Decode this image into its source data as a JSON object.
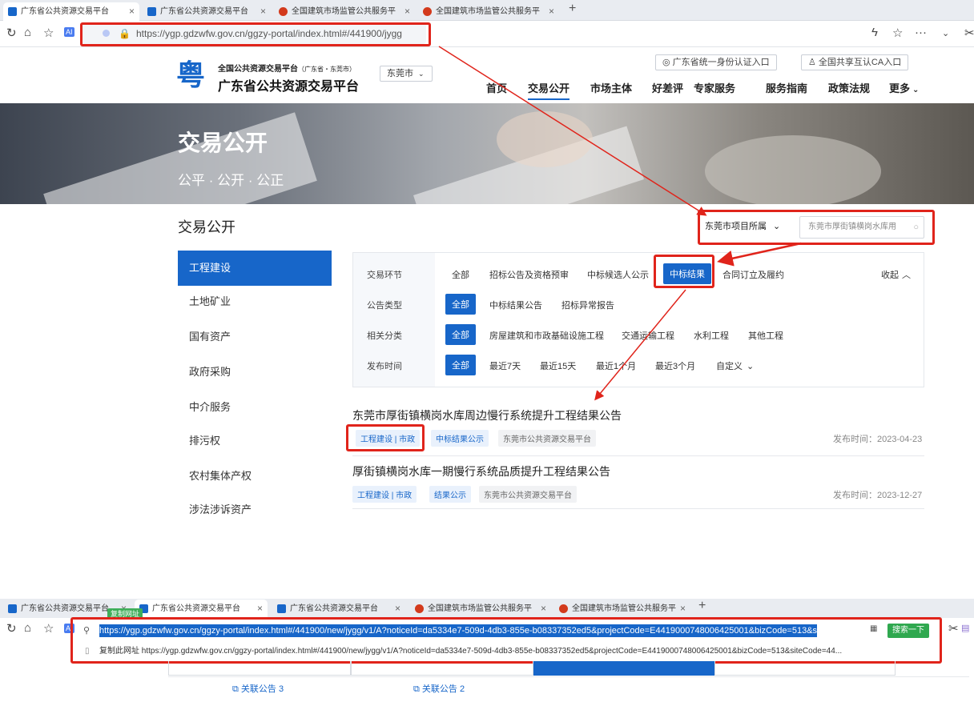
{
  "browser": {
    "tabs": [
      {
        "label": "广东省公共资源交易平台",
        "active": true
      },
      {
        "label": "广东省公共资源交易平台",
        "active": false
      },
      {
        "label": "全国建筑市场监管公共服务平",
        "active": false
      },
      {
        "label": "全国建筑市场监管公共服务平",
        "active": false
      }
    ],
    "url": "https://ygp.gdzwfw.gov.cn/ggzy-portal/index.html#/441900/jygg",
    "url_host": "ygp.gdzwfw.gov.cn",
    "ai_badge": "AI"
  },
  "site": {
    "subtitle": "全国公共资源交易平台",
    "subtitle_small": "（广东省・东莞市）",
    "title": "广东省公共资源交易平台",
    "city": "东莞市",
    "toplinks": [
      "广东省统一身份认证入口",
      "全国共享互认CA入口"
    ],
    "nav": [
      "首页",
      "交易公开",
      "市场主体",
      "好差评",
      "专家服务",
      "服务指南",
      "政策法规",
      "更多"
    ]
  },
  "banner": {
    "title": "交易公开",
    "subtitle": "公平 · 公开 · 公正"
  },
  "section": {
    "title": "交易公开",
    "project_select": "东莞市项目所属",
    "search_value": "东莞市厚街镇横岗水库用"
  },
  "sidebar": [
    "工程建设",
    "土地矿业",
    "国有资产",
    "政府采购",
    "中介服务",
    "排污权",
    "农村集体产权",
    "涉法涉诉资产"
  ],
  "filters": {
    "collapse": "收起",
    "rows": [
      {
        "label": "交易环节",
        "options": [
          "全部",
          "招标公告及资格预审",
          "中标候选人公示",
          "中标结果",
          "合同订立及履约"
        ]
      },
      {
        "label": "公告类型",
        "options": [
          "全部",
          "中标结果公告",
          "招标异常报告"
        ]
      },
      {
        "label": "相关分类",
        "options": [
          "全部",
          "房屋建筑和市政基础设施工程",
          "交通运输工程",
          "水利工程",
          "其他工程"
        ]
      },
      {
        "label": "发布时间",
        "options": [
          "全部",
          "最近7天",
          "最近15天",
          "最近1个月",
          "最近3个月",
          "自定义"
        ]
      }
    ]
  },
  "results": [
    {
      "title": "东莞市厚街镇横岗水库周边慢行系统提升工程结果公告",
      "tags": [
        "工程建设 | 市政",
        "中标结果公示",
        "东莞市公共资源交易平台"
      ],
      "date": "发布时间：2023-04-23"
    },
    {
      "title": "厚街镇横岗水库一期慢行系统品质提升工程结果公告",
      "tags": [
        "工程建设 | 市政",
        "结果公示",
        "东莞市公共资源交易平台"
      ],
      "date": "发布时间：2023-12-27"
    }
  ],
  "second": {
    "tabs": [
      {
        "label": "广东省公共资源交易平台"
      },
      {
        "label": "广东省公共资源交易平台"
      },
      {
        "label": "广东省公共资源交易平台"
      },
      {
        "label": "全国建筑市场监管公共服务平"
      },
      {
        "label": "全国建筑市场监管公共服务平"
      }
    ],
    "tooltip": "复制网址",
    "url": "https://ygp.gdzwfw.gov.cn/ggzy-portal/index.html#/441900/new/jygg/v1/A?noticeId=da5334e7-509d-4db3-855e-b08337352ed5&projectCode=E4419000748006425001&bizCode=513&s",
    "copy_line": "复制此网址 https://ygp.gdzwfw.gov.cn/ggzy-portal/index.html#/441900/new/jygg/v1/A?noticeId=da5334e7-509d-4db3-855e-b08337352ed5&projectCode=E4419000748006425001&bizCode=513&siteCode=44...",
    "search_button": "搜索一下",
    "related": [
      "关联公告 3",
      "关联公告 2"
    ]
  },
  "colors": {
    "brand": "#1766c9",
    "annotation": "#e0241b",
    "go": "#2fa84f"
  }
}
